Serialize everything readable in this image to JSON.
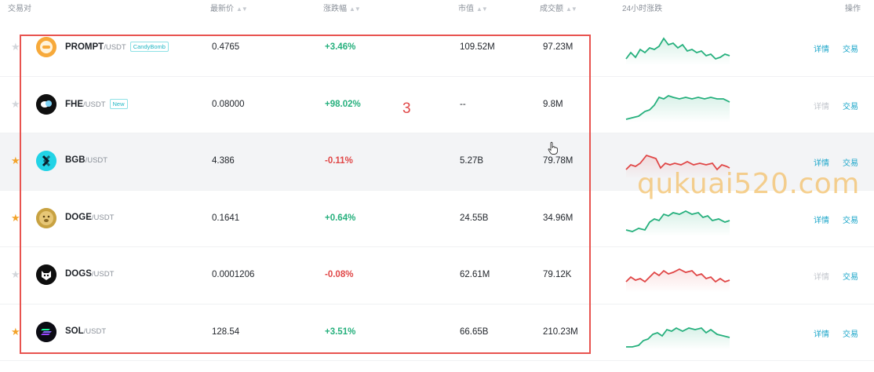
{
  "header": {
    "pair": "交易对",
    "price": "最新价",
    "change": "涨跌幅",
    "market_cap": "市值",
    "volume": "成交额",
    "trend": "24小时涨跌",
    "actions": "操作"
  },
  "rows": [
    {
      "base": "PROMPT",
      "quote": "/USDT",
      "tag": "CandyBomb",
      "price": "0.4765",
      "change": "+3.46%",
      "direction": "up",
      "market_cap": "109.52M",
      "volume": "97.23M",
      "detail": "详情",
      "trade": "交易",
      "favorite": false,
      "icon": "prompt-coin-icon"
    },
    {
      "base": "FHE",
      "quote": "/USDT",
      "tag": "New",
      "price": "0.08000",
      "change": "+98.02%",
      "direction": "up",
      "market_cap": "--",
      "volume": "9.8M",
      "detail": "详情",
      "trade": "交易",
      "favorite": false,
      "icon": "fhe-coin-icon"
    },
    {
      "base": "BGB",
      "quote": "/USDT",
      "tag": "",
      "price": "4.386",
      "change": "-0.11%",
      "direction": "down",
      "market_cap": "5.27B",
      "volume": "79.78M",
      "detail": "详情",
      "trade": "交易",
      "favorite": true,
      "icon": "bgb-coin-icon"
    },
    {
      "base": "DOGE",
      "quote": "/USDT",
      "tag": "",
      "price": "0.1641",
      "change": "+0.64%",
      "direction": "up",
      "market_cap": "24.55B",
      "volume": "34.96M",
      "detail": "详情",
      "trade": "交易",
      "favorite": true,
      "icon": "doge-coin-icon"
    },
    {
      "base": "DOGS",
      "quote": "/USDT",
      "tag": "",
      "price": "0.0001206",
      "change": "-0.08%",
      "direction": "down",
      "market_cap": "62.61M",
      "volume": "79.12K",
      "detail": "详情",
      "trade": "交易",
      "favorite": false,
      "icon": "dogs-coin-icon"
    },
    {
      "base": "SOL",
      "quote": "/USDT",
      "tag": "",
      "price": "128.54",
      "change": "+3.51%",
      "direction": "up",
      "market_cap": "66.65B",
      "volume": "210.23M",
      "detail": "详情",
      "trade": "交易",
      "favorite": true,
      "icon": "sol-coin-icon"
    }
  ],
  "colors": {
    "up": "#26b07d",
    "down": "#e04646",
    "accent": "#1aa5c9",
    "favorite": "#f3a32a",
    "annotation": "#e8534f"
  },
  "annotation": {
    "number": "3"
  },
  "watermark": {
    "text": "qukuai520.com"
  }
}
